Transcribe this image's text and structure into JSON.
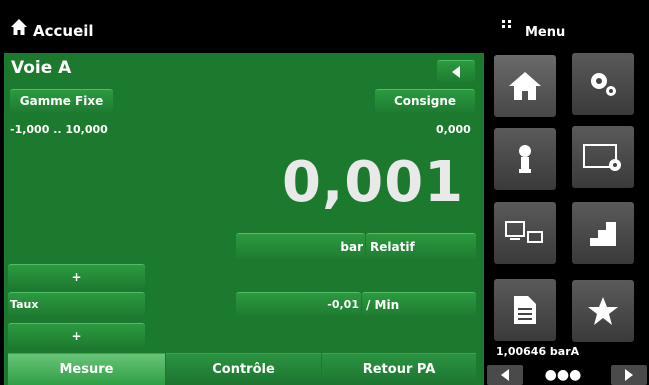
{
  "topbar": {
    "title": "Accueil",
    "menu_label": "Menu"
  },
  "panel": {
    "channel": "Voie A",
    "range_button": "Gamme Fixe",
    "setpoint_button": "Consigne",
    "range_text": "-1,000 .. 10,000",
    "setpoint_value": "0,000",
    "reading": "0,001",
    "unit": "bar",
    "mode": "Relatif",
    "plus_top": "+",
    "rate_label": "Taux",
    "rate_value": "-0,01",
    "rate_unit": "/ Min",
    "plus_bottom": "+"
  },
  "tabs": [
    {
      "label": "Mesure",
      "active": true
    },
    {
      "label": "Contrôle",
      "active": false
    },
    {
      "label": "Retour PA",
      "active": false
    }
  ],
  "side": {
    "tiles": [
      "home-icon",
      "settings-gears-icon",
      "sensor-icon",
      "display-settings-icon",
      "remote-computer-icon",
      "steps-icon",
      "document-icon",
      "favorite-star-icon"
    ],
    "barometer": "1,00646  barA",
    "pager": "●●●"
  },
  "colors": {
    "panel": "#1c7a2f",
    "button": "#2b9a3f",
    "tile": "#4a4a4a",
    "background": "#000000"
  }
}
